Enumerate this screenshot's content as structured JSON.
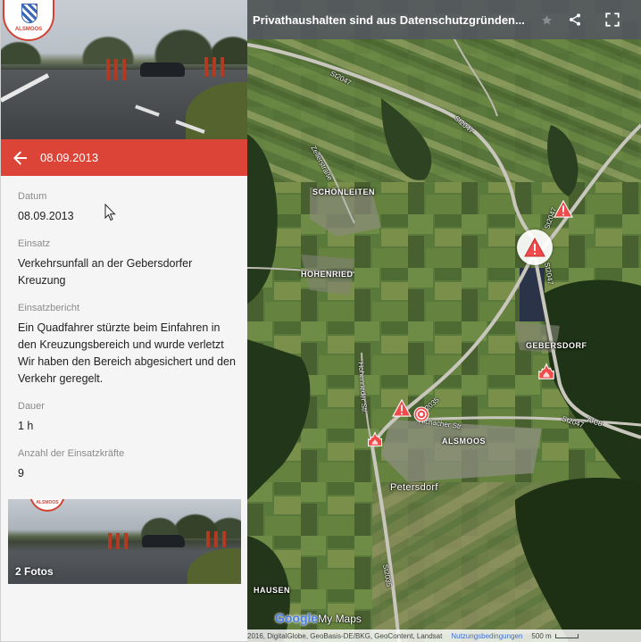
{
  "detail": {
    "header_title": "08.09.2013",
    "logo_text": "ALSMOOS",
    "fields": [
      {
        "label": "Datum",
        "value": "08.09.2013"
      },
      {
        "label": "Einsatz",
        "value": "Verkehrsunfall an der Gebersdorfer Kreuzung"
      },
      {
        "label": "Einsatzbericht",
        "value": "Ein Quadfahrer stürzte beim Einfahren in den Kreuzungsbereich und wurde verletzt Wir haben den Bereich abgesichert und den Verkehr geregelt."
      },
      {
        "label": "Dauer",
        "value": "1 h"
      },
      {
        "label": "Anzahl der Einsatzkräfte",
        "value": "9"
      }
    ],
    "photos_label": "2 Fotos"
  },
  "map": {
    "title": "Privathaushalten sind aus Datenschutzgründen...",
    "icons": {
      "share": "share-icon",
      "fullscreen": "fullscreen-icon",
      "star": "star-icon",
      "back": "arrow-left-icon"
    },
    "places": {
      "schoenleiten": "SCHÖNLEITEN",
      "hohenried": "HOHENRIED",
      "gebersdorf": "GEBERSDORF",
      "alsmoos": "ALSMOOS",
      "petersdorf": "Petersdorf",
      "hausen": "HAUSEN"
    },
    "streets": {
      "st2047_top": "St2047",
      "st2047_mid": "St2047",
      "st2047_right": "St2047",
      "st2047_vertical": "St2047",
      "aic8": "AIC8",
      "zellerstrasse": "Zellerstraße",
      "hohenrieder": "Hohenrieder Str.",
      "aichacher": "Aichacher Str.",
      "st2035_a": "2035",
      "st2035_b": "St2035"
    },
    "attribution": {
      "text": "2016, DigitalGlobe, GeoBasis-DE/BKG, GeoContent, Landsat",
      "terms": "Nutzungsbedingungen",
      "scale": "500 m"
    },
    "google_logo": "Google",
    "mymaps": "My Maps",
    "colors": {
      "accent": "#db4437",
      "marker": "#f04a4a"
    }
  }
}
